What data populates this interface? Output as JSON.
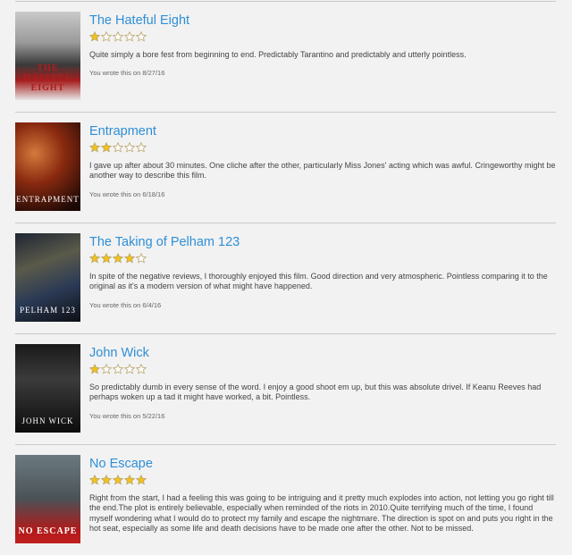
{
  "reviews": [
    {
      "title": "The Hateful Eight",
      "rating": 1,
      "text": "Quite simply a bore fest from beginning to end. Predictably Tarantino and predictably and utterly pointless.",
      "meta": "You wrote this on 8/27/16",
      "poster_text": "THE HATEFUL EIGHT",
      "poster_style": "hateful"
    },
    {
      "title": "Entrapment",
      "rating": 2,
      "text": "I gave up after about 30 minutes. One cliche after the other, particularly Miss Jones' acting which was awful. Cringeworthy might be another way to describe this film.",
      "meta": "You wrote this on 6/18/16",
      "poster_text": "ENTRAPMENT",
      "poster_style": "entrapment"
    },
    {
      "title": "The Taking of Pelham 123",
      "rating": 4,
      "text": "In spite of the negative reviews, I thoroughly enjoyed this film. Good direction and very atmospheric. Pointless comparing it to the original as it's a modern version of what might have happened.",
      "meta": "You wrote this on 6/4/16",
      "poster_text": "PELHAM 123",
      "poster_style": "pelham"
    },
    {
      "title": "John Wick",
      "rating": 1,
      "text": "So predictably dumb in every sense of the word. I enjoy a good shoot em up, but this was absolute drivel. If Keanu Reeves had perhaps woken up a tad it might have worked, a bit. Pointless.",
      "meta": "You wrote this on 5/22/16",
      "poster_text": "JOHN WICK",
      "poster_style": "johnwick"
    },
    {
      "title": "No Escape",
      "rating": 5,
      "text": "Right from the start, I had a feeling this was going to be intriguing and it pretty much explodes into action, not letting you go right till the end.The plot is entirely believable, especially when reminded of the riots in 2010.Quite terrifying much of the time, I found myself wondering what I would do to protect my family and escape the nightmare. The direction is spot on and puts you right in the hot seat, especially as some life and death decisions have to be made one after the other. Not to be missed.",
      "meta": "",
      "poster_text": "NO ESCAPE",
      "poster_style": "noescape"
    }
  ],
  "colors": {
    "link": "#2e8fd6",
    "star_filled": "#f2c21b",
    "star_empty": "#ffffff",
    "star_stroke": "#b8a46a"
  },
  "icons": {
    "star": "star-icon"
  }
}
